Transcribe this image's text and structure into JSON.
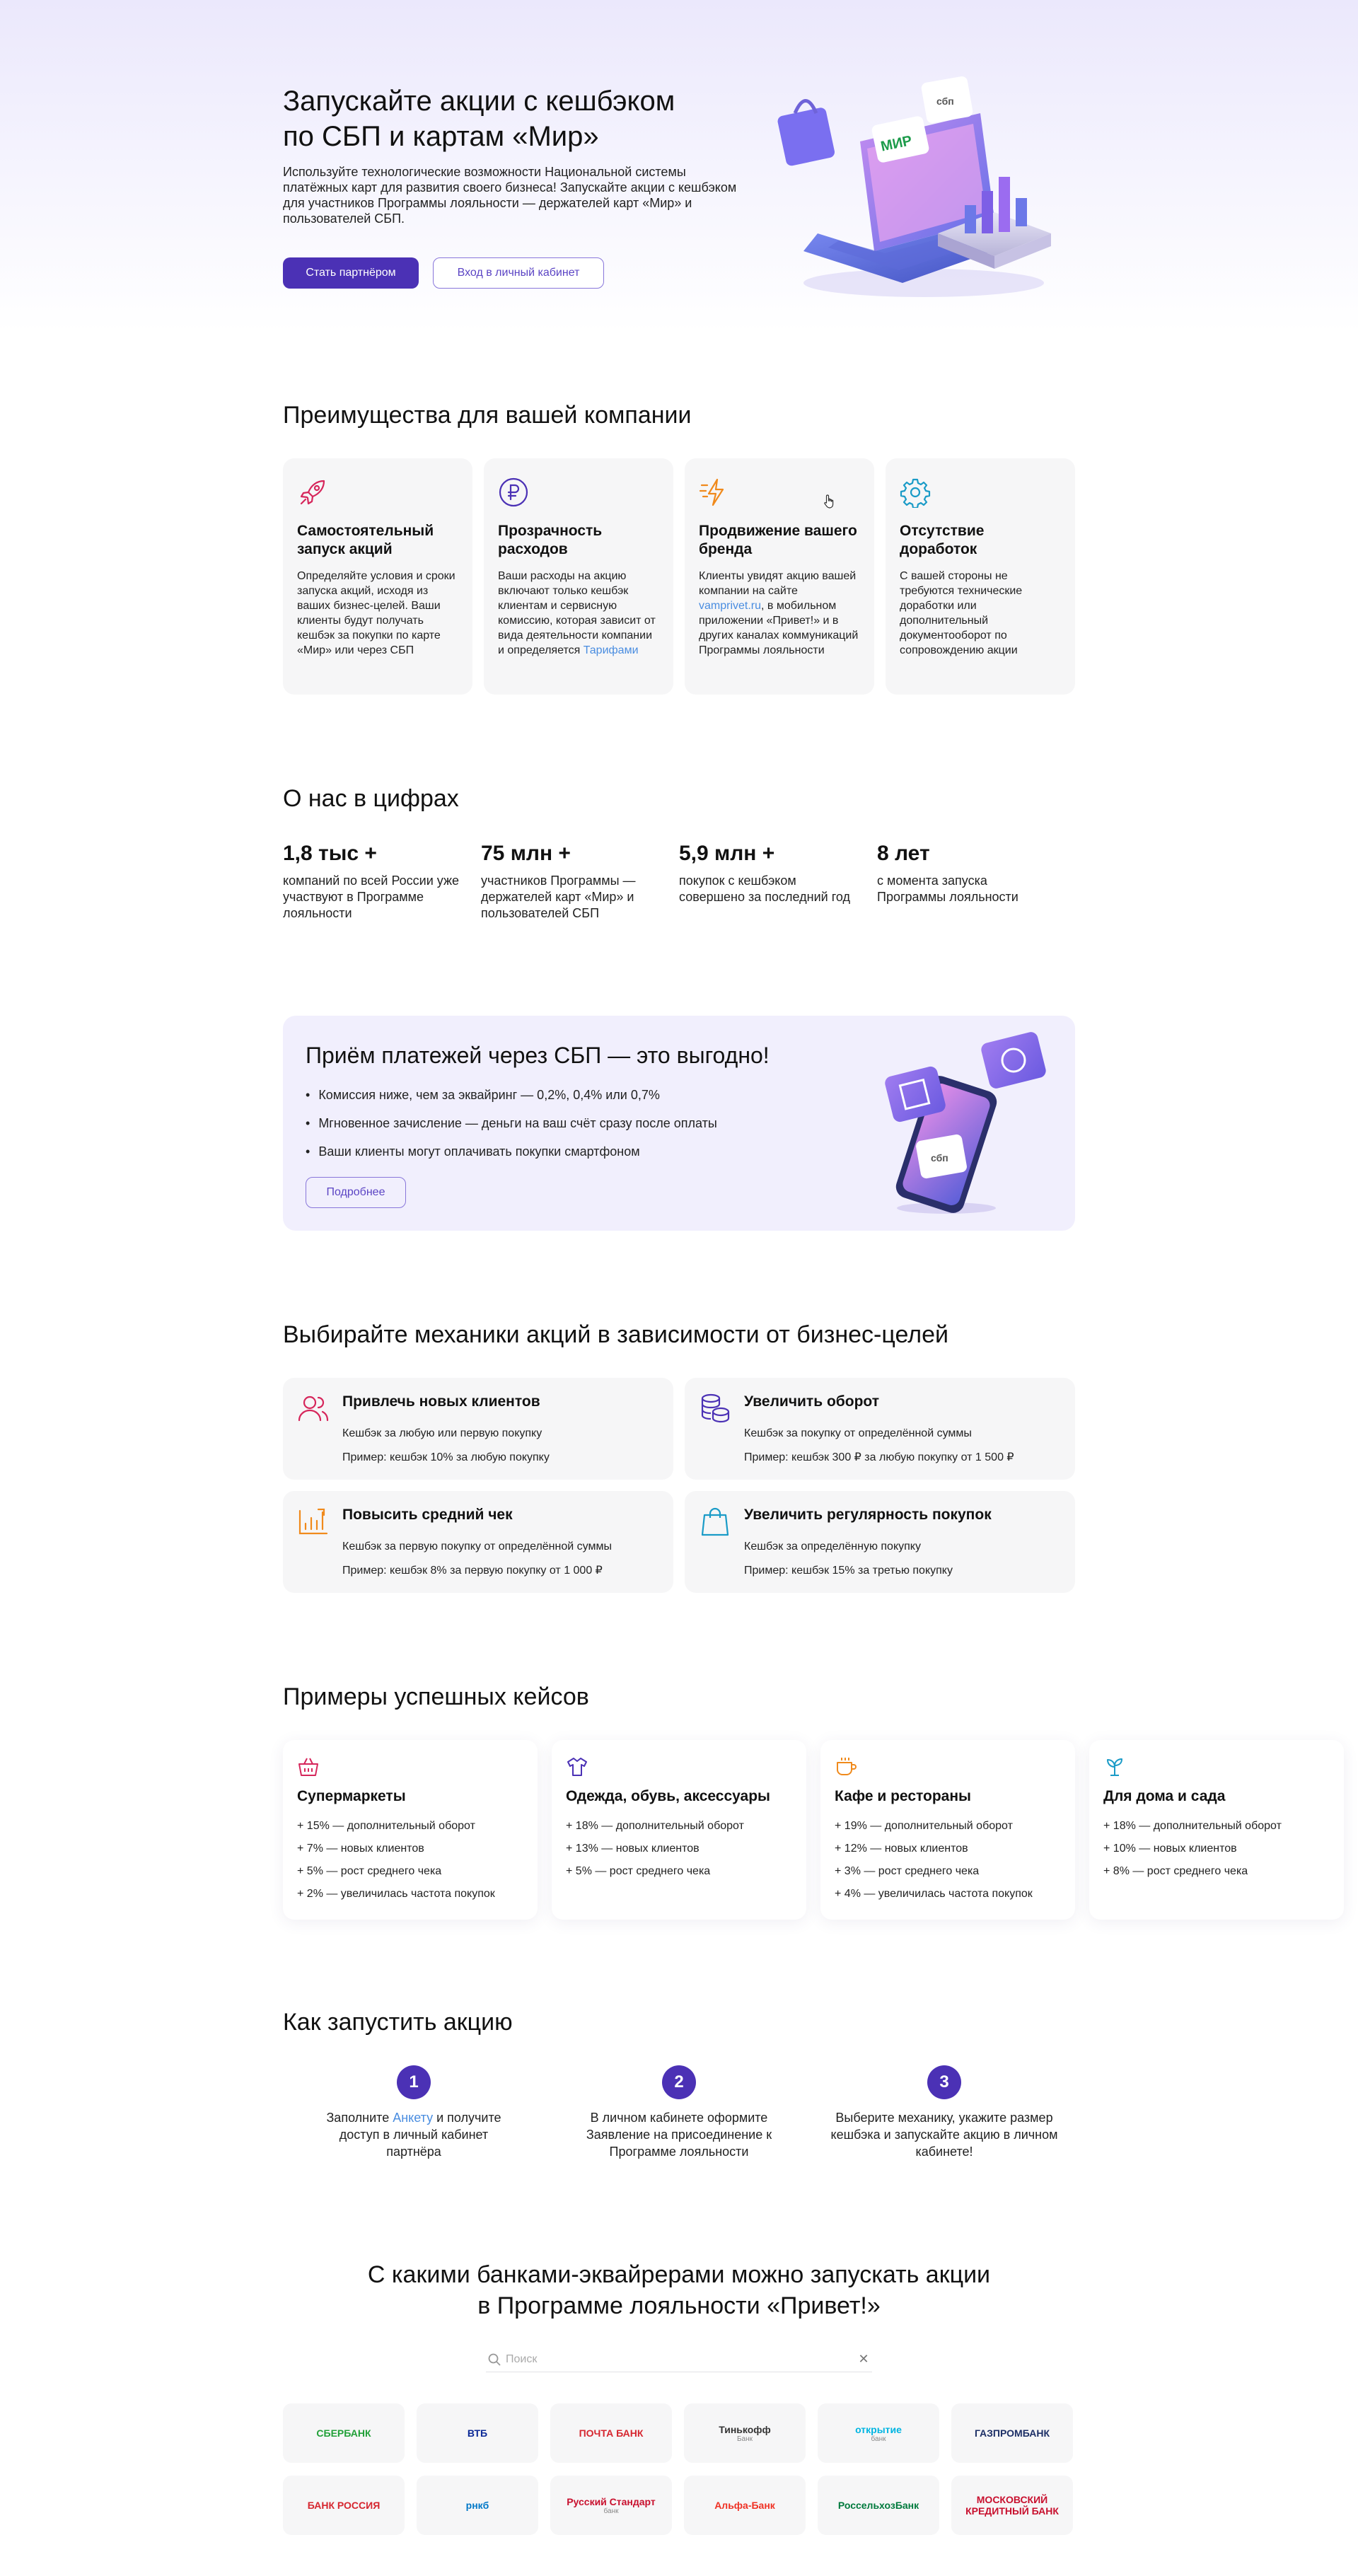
{
  "hero": {
    "title_line1": "Запускайте акции с кешбэком",
    "title_line2": "по СБП и картам «Мир»",
    "subtitle": "Используйте технологические возможности Национальной системы платёжных карт для развития своего бизнеса! Запускайте акции с кешбэком для участников Программы лояльности — держателей карт «Мир» и пользователей СБП.",
    "primary_button": "Стать партнёром",
    "secondary_button": "Вход в личный кабинет",
    "art_labels": {
      "sbp": "сбп",
      "mir": "МИР"
    }
  },
  "benefits": {
    "title": "Преимущества для вашей компании",
    "items": [
      {
        "icon": "rocket-icon",
        "title": "Самостоятельный запуск акций",
        "text": "Определяйте условия и сроки запуска акций, исходя из ваших бизнес-целей. Ваши клиенты будут получать кешбэк за покупки по карте «Мир» или через СБП"
      },
      {
        "icon": "ruble-icon",
        "title": "Прозрачность расходов",
        "text_before": "Ваши расходы на акцию включают только кешбэк клиентам и сервисную комиссию, которая зависит от вида деятельности компании и определяется ",
        "link": "Тарифами"
      },
      {
        "icon": "lightning-icon",
        "title": "Продвижение вашего бренда",
        "text_before": "Клиенты увидят акцию вашей компании на сайте ",
        "link": "vamprivet.ru",
        "text_after": ", в мобильном приложении «Привет!» и в других каналах коммуникаций Программы лояльности"
      },
      {
        "icon": "gear-icon",
        "title": "Отсутствие доработок",
        "text": "С вашей стороны не требуются технические доработки или дополнительный документооборот по сопровождению акции"
      }
    ]
  },
  "stats": {
    "title": "О нас в цифрах",
    "items": [
      {
        "num": "1,8 тыс +",
        "text": "компаний по всей России уже участвуют в Программе лояльности"
      },
      {
        "num": "75 млн +",
        "text": "участников Программы — держателей карт «Мир» и пользователей СБП"
      },
      {
        "num": "5,9 млн +",
        "text": "покупок с кешбэком совершено за последний год"
      },
      {
        "num": "8 лет",
        "text": "с момента запуска Программы лояльности"
      }
    ]
  },
  "sbp_banner": {
    "title": "Приём платежей через СБП — это выгодно!",
    "bullets": [
      "Комиссия ниже, чем за эквайринг — 0,2%, 0,4% или 0,7%",
      "Мгновенное зачисление — деньги на ваш счёт сразу после оплаты",
      "Ваши клиенты могут оплачивать покупки смартфоном"
    ],
    "button": "Подробнее",
    "art_label": "сбп"
  },
  "mechanics": {
    "title": "Выбирайте механики акций в зависимости от бизнес-целей",
    "items": [
      {
        "icon": "users-icon",
        "title": "Привлечь новых клиентов",
        "line1": "Кешбэк за любую или первую покупку",
        "line2": "Пример: кешбэк 10% за любую покупку"
      },
      {
        "icon": "coins-icon",
        "title": "Увеличить оборот",
        "line1": "Кешбэк за покупку от определённой суммы",
        "line2": "Пример: кешбэк 300 ₽ за любую покупку от 1 500 ₽"
      },
      {
        "icon": "bar-chart-icon",
        "title": "Повысить средний чек",
        "line1": "Кешбэк за первую покупку от определённой суммы",
        "line2": "Пример: кешбэк 8% за первую покупку от 1 000 ₽"
      },
      {
        "icon": "shopping-bag-icon",
        "title": "Увеличить регулярность покупок",
        "line1": "Кешбэк за определённую покупку",
        "line2": "Пример: кешбэк 15% за третью покупку"
      }
    ]
  },
  "cases": {
    "title": "Примеры успешных кейсов",
    "items": [
      {
        "icon": "basket-icon",
        "title": "Супермаркеты",
        "lines": [
          "+ 15% — дополнительный оборот",
          "+ 7% — новых клиентов",
          "+ 5% — рост среднего чека",
          "+ 2% — увеличилась частота покупок"
        ]
      },
      {
        "icon": "shirt-icon",
        "title": "Одежда, обувь, аксессуары",
        "lines": [
          "+ 18% — дополнительный оборот",
          "+ 13% — новых клиентов",
          "+ 5% — рост среднего чека"
        ]
      },
      {
        "icon": "coffee-cup-icon",
        "title": "Кафе и рестораны",
        "lines": [
          "+ 19% — дополнительный оборот",
          "+ 12% — новых клиентов",
          "+ 3% — рост среднего чека",
          "+ 4% — увеличилась частота покупок"
        ]
      },
      {
        "icon": "plant-icon",
        "title": "Для дома и сада",
        "lines": [
          "+ 18% — дополнительный оборот",
          "+ 10% — новых клиентов",
          "+ 8% — рост среднего чека"
        ]
      }
    ]
  },
  "steps": {
    "title": "Как запустить акцию",
    "items": [
      {
        "num": "1",
        "text_before": "Заполните ",
        "link": "Анкету",
        "text_after": " и получите доступ в личный кабинет партнёра"
      },
      {
        "num": "2",
        "text": "В личном кабинете оформите Заявление на присоединение к Программе лояльности"
      },
      {
        "num": "3",
        "text": "Выберите механику, укажите размер кешбэка и запускайте акцию в личном кабинете!"
      }
    ]
  },
  "banks": {
    "title_line1": "С какими банками-эквайрерами можно запускать акции",
    "title_line2": "в Программе лояльности «Привет!»",
    "search_placeholder": "Поиск",
    "items": [
      {
        "name": "СБЕРБАНК",
        "color": "#21a038"
      },
      {
        "name": "ВТБ",
        "color": "#0a2896"
      },
      {
        "name": "ПОЧТА БАНК",
        "color": "#d6262f"
      },
      {
        "name": "Тинькофф",
        "sub": "Банк",
        "color": "#333333"
      },
      {
        "name": "открытие",
        "sub": "банк",
        "color": "#00b5e2"
      },
      {
        "name": "ГАЗПРОМБАНК",
        "color": "#1c2f66"
      },
      {
        "name": "БАНК РОССИЯ",
        "color": "#d6262f"
      },
      {
        "name": "рнкб",
        "color": "#0078c8"
      },
      {
        "name": "Русский Стандарт",
        "sub": "банк",
        "color": "#c8102e"
      },
      {
        "name": "Альфа-Банк",
        "color": "#ef3124"
      },
      {
        "name": "РоссельхозБанк",
        "color": "#007a3d"
      },
      {
        "name": "МОСКОВСКИЙ КРЕДИТНЫЙ БАНК",
        "color": "#c8102e"
      }
    ]
  }
}
